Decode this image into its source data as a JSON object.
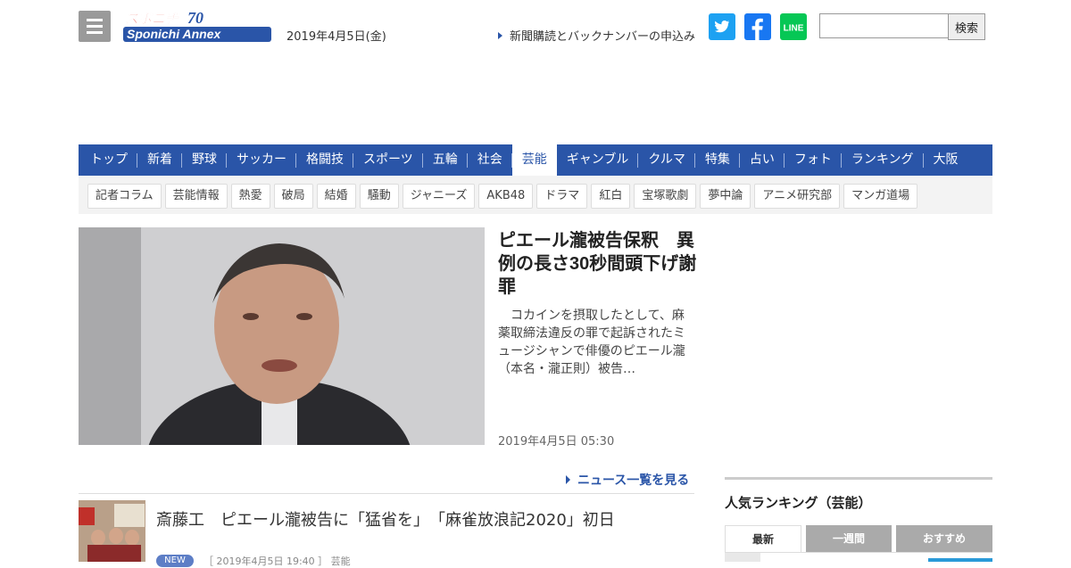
{
  "header": {
    "date": "2019年4月5日(金)",
    "subscribe_link": "新聞購読とバックナンバーの申込み",
    "search_placeholder": "",
    "search_button": "検索",
    "logo_line1": "スポニチ",
    "logo_line2": "Sponichi Annex",
    "logo_badge": "70"
  },
  "nav": {
    "items": [
      "トップ",
      "新着",
      "野球",
      "サッカー",
      "格闘技",
      "スポーツ",
      "五輪",
      "社会",
      "芸能",
      "ギャンブル",
      "クルマ",
      "特集",
      "占い",
      "フォト",
      "ランキング",
      "大阪"
    ],
    "active": "芸能"
  },
  "subnav": {
    "items": [
      "記者コラム",
      "芸能情報",
      "熱愛",
      "破局",
      "結婚",
      "騒動",
      "ジャニーズ",
      "AKB48",
      "ドラマ",
      "紅白",
      "宝塚歌劇",
      "夢中論",
      "アニメ研究部",
      "マンガ道場"
    ]
  },
  "feature": {
    "title": "ピエール瀧被告保釈　異例の長さ30秒間頭下げ謝罪",
    "body": "　コカインを摂取したとして、麻薬取締法違反の罪で起訴されたミュージシャンで俳優のピエール瀧（本名・瀧正則）被告…",
    "date": "2019年4月5日 05:30"
  },
  "more_link": "ニュース一覧を見る",
  "list": [
    {
      "title": "斎藤工　ピエール瀧被告に「猛省を」　「麻雀放浪記2020」初日",
      "badge": "NEW",
      "meta": "［ 2019年4月5日 19:40 ］ 芸能"
    }
  ],
  "sidebar": {
    "ranking_title": "人気ランキング（芸能）",
    "tabs": [
      "最新",
      "一週間",
      "おすすめ"
    ],
    "active_tab": "最新"
  },
  "colors": {
    "nav_blue": "#2a55a8",
    "twitter": "#1da1f2",
    "facebook": "#1877f2",
    "line": "#06c755"
  },
  "icons": [
    "menu-icon",
    "twitter-icon",
    "facebook-icon",
    "line-icon",
    "triangle-right-icon"
  ]
}
